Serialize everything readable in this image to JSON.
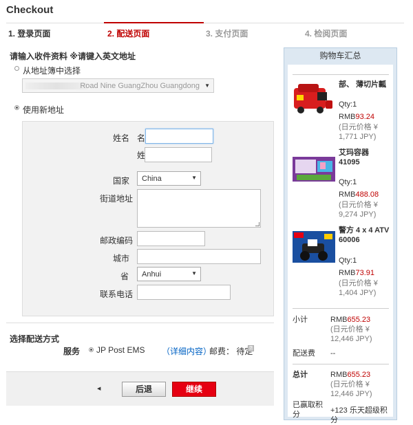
{
  "page": {
    "title": "Checkout"
  },
  "steps": [
    {
      "label": "1. 登录页面",
      "state": "done"
    },
    {
      "label": "2. 配送页面",
      "state": "active"
    },
    {
      "label": "3. 支付页面",
      "state": "todo"
    },
    {
      "label": "4. 检阅页面",
      "state": "todo"
    }
  ],
  "address": {
    "section_title": "请输入收件资料 ※请键入英文地址",
    "option_book_label": "从地址簿中选择",
    "book_selected": "Road Nine GuangZhou Guangdong",
    "option_new_label": "使用新地址",
    "form": {
      "name_label": "姓名",
      "first_name_label": "名",
      "last_name_label": "姓",
      "country_label": "国家",
      "country_value": "China",
      "street_label": "街道地址",
      "postcode_label": "邮政编码",
      "city_label": "城市",
      "province_label": "省",
      "province_value": "Anhui",
      "phone_label": "联系电话"
    }
  },
  "shipping": {
    "section_title": "选择配送方式",
    "service_label": "服务",
    "method": "JP Post EMS",
    "details_link": "（详细内容）",
    "postage_label": "邮费： 待定"
  },
  "actions": {
    "back_label": "后退",
    "next_label": "继续"
  },
  "cart": {
    "title": "购物车汇总",
    "items": [
      {
        "name": "部、 薄切片瓤",
        "qty": "Qty:1",
        "currency": "RMB",
        "price": "93.24",
        "jpy": "(日元价格 ¥ 1,771 JPY)"
      },
      {
        "name": "艾玛容器 41095",
        "qty": "Qty:1",
        "currency": "RMB",
        "price": "488.08",
        "jpy": "(日元价格 ¥ 9,274 JPY)"
      },
      {
        "name": "警方 4 x 4 ATV 60006",
        "qty": "Qty:1",
        "currency": "RMB",
        "price": "73.91",
        "jpy": "(日元价格 ¥ 1,404 JPY)"
      }
    ],
    "subtotal_label": "小计",
    "subtotal_currency": "RMB",
    "subtotal_value": "655.23",
    "subtotal_jpy": "(日元价格 ¥ 12,446 JPY)",
    "shipping_label": "配送费",
    "shipping_value": "--",
    "total_label": "总计",
    "total_currency": "RMB",
    "total_value": "655.23",
    "total_jpy": "(日元价格 ¥ 12,446 JPY)",
    "points_label": "已赢取积分",
    "points_value": "+123 乐天超级积分"
  },
  "colors": {
    "accent_red": "#bf0000",
    "link_blue": "#0062c4",
    "cart_border": "#b8cde0"
  }
}
